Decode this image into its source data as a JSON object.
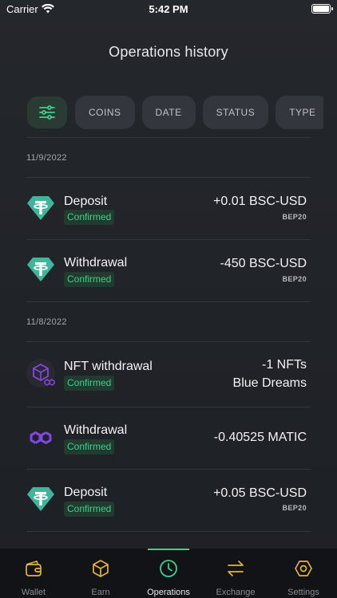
{
  "status_bar": {
    "carrier": "Carrier",
    "time": "5:42 PM"
  },
  "header": {
    "title": "Operations history"
  },
  "filters": {
    "chips": [
      "COINS",
      "DATE",
      "STATUS",
      "TYPE"
    ]
  },
  "groups": [
    {
      "date": "11/9/2022",
      "operations": [
        {
          "title": "Deposit",
          "status": "Confirmed",
          "amount": "+0.01 BSC-USD",
          "network": "BEP20",
          "icon": "tether-icon"
        },
        {
          "title": "Withdrawal",
          "status": "Confirmed",
          "amount": "-450 BSC-USD",
          "network": "BEP20",
          "icon": "tether-icon"
        }
      ]
    },
    {
      "date": "11/8/2022",
      "operations": [
        {
          "title": "NFT withdrawal",
          "status": "Confirmed",
          "amount": "-1 NFTs",
          "subtitle": "Blue Dreams",
          "icon": "nft-polygon-icon"
        },
        {
          "title": "Withdrawal",
          "status": "Confirmed",
          "amount": "-0.40525 MATIC",
          "icon": "polygon-icon"
        },
        {
          "title": "Deposit",
          "status": "Confirmed",
          "amount": "+0.05 BSC-USD",
          "network": "BEP20",
          "icon": "tether-icon"
        }
      ]
    }
  ],
  "tabbar": {
    "active": "Operations",
    "tabs": [
      {
        "label": "Wallet",
        "icon": "wallet-icon"
      },
      {
        "label": "Earn",
        "icon": "cube-icon"
      },
      {
        "label": "Operations",
        "icon": "clock-icon"
      },
      {
        "label": "Exchange",
        "icon": "exchange-arrows-icon"
      },
      {
        "label": "Settings",
        "icon": "hexagon-gear-icon"
      }
    ]
  },
  "colors": {
    "accent": "#3fcf8e",
    "tether": "#40b59b",
    "polygon": "#8247e5",
    "background": "#24272c",
    "tabbar": "#121316"
  }
}
